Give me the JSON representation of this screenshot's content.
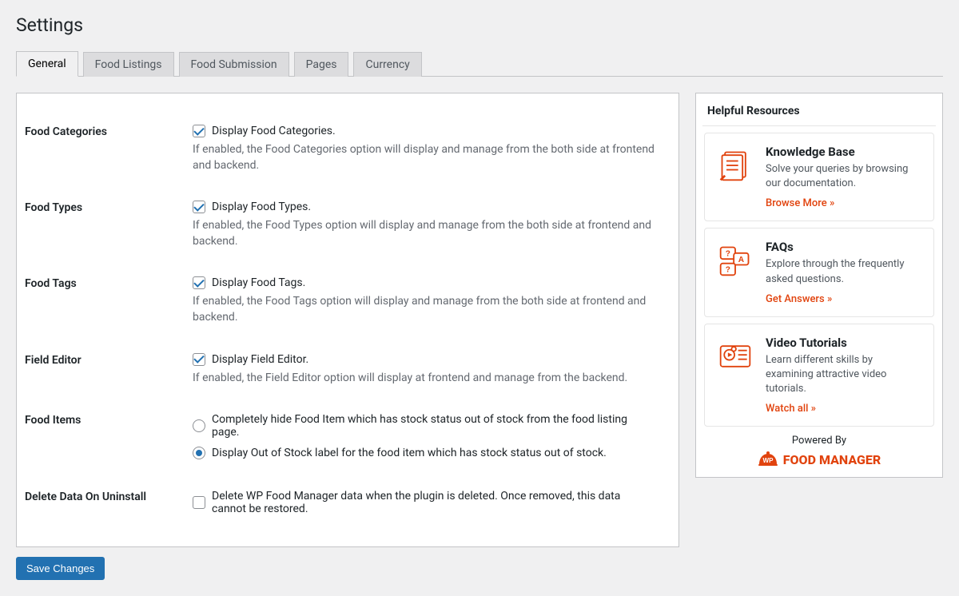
{
  "page": {
    "title": "Settings"
  },
  "tabs": {
    "t0": "General",
    "t1": "Food Listings",
    "t2": "Food Submission",
    "t3": "Pages",
    "t4": "Currency"
  },
  "rows": {
    "food_categories": {
      "label": "Food Categories",
      "option": "Display Food Categories.",
      "desc": "If enabled, the Food Categories option will display and manage from the both side at frontend and backend."
    },
    "food_types": {
      "label": "Food Types",
      "option": "Display Food Types.",
      "desc": "If enabled, the Food Types option will display and manage from the both side at frontend and backend."
    },
    "food_tags": {
      "label": "Food Tags",
      "option": "Display Food Tags.",
      "desc": "If enabled, the Food Tags option will display and manage from the both side at frontend and backend."
    },
    "field_editor": {
      "label": "Field Editor",
      "option": "Display Field Editor.",
      "desc": "If enabled, the Field Editor option will display at frontend and manage from the backend."
    },
    "food_items": {
      "label": "Food Items",
      "opt1": "Completely hide Food Item which has stock status out of stock from the food listing page.",
      "opt2": "Display Out of Stock label for the food item which has stock status out of stock."
    },
    "delete_data": {
      "label": "Delete Data On Uninstall",
      "option": "Delete WP Food Manager data when the plugin is deleted. Once removed, this data cannot be restored."
    }
  },
  "actions": {
    "save": "Save Changes"
  },
  "sidebar": {
    "heading": "Helpful Resources",
    "kb": {
      "title": "Knowledge Base",
      "desc": "Solve your queries by browsing our documentation.",
      "link": "Browse More »"
    },
    "faq": {
      "title": "FAQs",
      "desc": "Explore through the frequently asked questions.",
      "link": "Get Answers »"
    },
    "vid": {
      "title": "Video Tutorials",
      "desc": "Learn different skills by examining attractive video tutorials.",
      "link": "Watch all »"
    },
    "powered_label": "Powered By",
    "brand": "FOOD MANAGER",
    "brand_badge": "WP"
  }
}
